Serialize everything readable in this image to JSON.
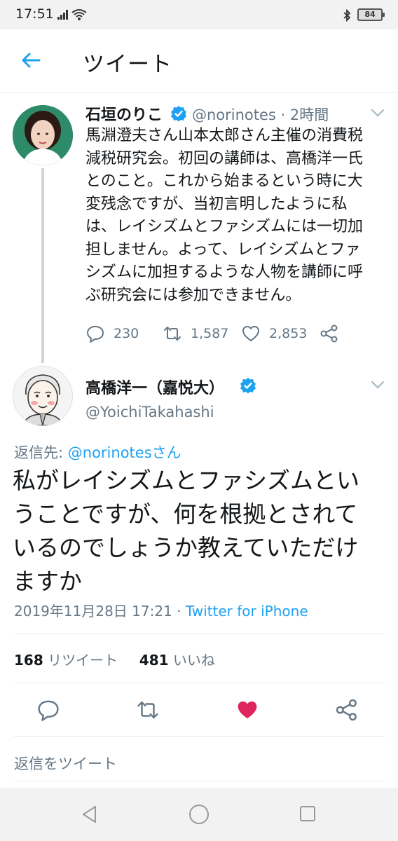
{
  "status_bar": {
    "time": "17:51",
    "battery": "84",
    "icons": [
      "signal-icon",
      "wifi-icon",
      "bluetooth-icon",
      "battery-icon"
    ]
  },
  "header": {
    "title": "ツイート",
    "back_icon": "back-arrow-icon"
  },
  "tweet1": {
    "name": "石垣のりこ",
    "handle": "@norinotes · 2時間",
    "body_lines": [
      "馬淵澄夫さん山本太郎さん主催の消費税",
      "減税研究会。初回の講師は、高橋洋一氏",
      "とのこと。これから始まるという時に大",
      "変残念ですが、当初言明したように私",
      "は、レイシズムとファシズムには一切加",
      "担しません。よって、レイシズムとファ",
      "シズムに加担するような人物を講師に呼",
      "ぶ研究会には参加できません。"
    ],
    "replies": "230",
    "retweets": "1,587",
    "likes": "2,853"
  },
  "tweet2": {
    "name": "高橋洋一（嘉悦大）",
    "handle": "@YoichiTakahashi",
    "reply_prefix": "返信先: ",
    "reply_mention": "@norinotesさん",
    "text_lines": [
      "私がレイシズムとファシズムとい",
      "うことですが、何を根拠とされて",
      "いるのでしょうか教えていただけ",
      "ますか"
    ],
    "timestamp": "2019年11月28日 17:21 · ",
    "source": "Twitter for iPhone",
    "retweet_count": "168",
    "retweet_label": " リツイート",
    "like_count": "481",
    "like_label": " いいね"
  },
  "compose": {
    "placeholder": "返信をツイート"
  },
  "colors": {
    "accent": "#1da1f2",
    "like": "#e0245e",
    "muted": "#657786",
    "text": "#14171a"
  }
}
